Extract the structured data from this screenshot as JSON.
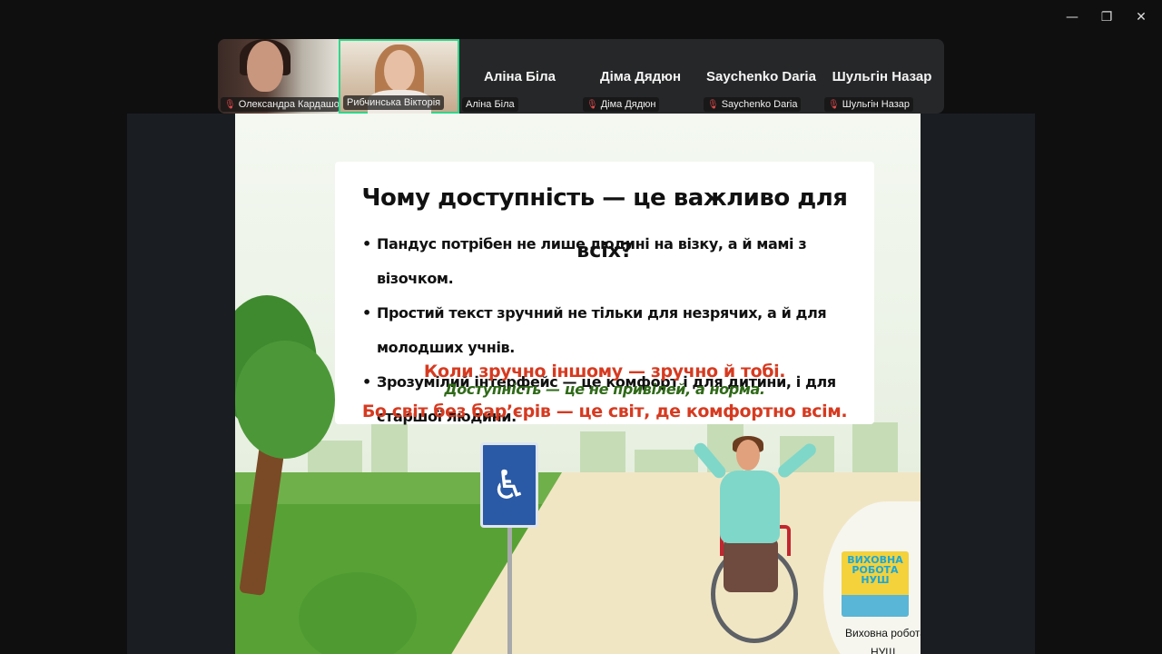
{
  "window": {
    "controls": {
      "minimize": "—",
      "restore": "❐",
      "close": "✕"
    }
  },
  "participants": [
    {
      "name": "Олександра Кардашо...",
      "has_video": true,
      "muted": true
    },
    {
      "name": "Рибчинська Вікторія",
      "has_video": true,
      "muted": false,
      "active_speaker": true
    },
    {
      "name": "Аліна Біла",
      "display_name": "Аліна Біла",
      "has_video": false,
      "muted": false
    },
    {
      "name": "Діма Дядюн",
      "display_name": "Діма Дядюн",
      "has_video": false,
      "muted": true
    },
    {
      "name": "Saychenko Daria",
      "display_name": "Saychenko Daria",
      "has_video": false,
      "muted": true
    },
    {
      "name": "Шульгін Назар",
      "display_name": "Шульгін Назар",
      "has_video": false,
      "muted": true
    }
  ],
  "slide": {
    "title_line1": "Чому доступність — це важливо для",
    "title_line2": "всіх?",
    "bullets": [
      "Пандус потрібен не лише людині на візку, а й мамі з візочком.",
      "Простий текст зручний не тільки для незрячих, а й для молодших учнів.",
      "Зрозумілий інтерфейс — це комфорт і для дитини, і для старшої людини."
    ],
    "red_line1": "Коли зручно іншому — зручно й тобі.",
    "green_line": "Доступність — це не привілей, а норма.",
    "red_line2": "Бо світ без бар’єрів — це світ, де комфортно всім.",
    "badge_title": "ВИХОВНА РОБОТА НУШ",
    "badge_caption_1": "Виховна робота",
    "badge_caption_2": "НУШ"
  },
  "icons": {
    "mic_muted": "muted-mic-icon",
    "wheelchair_sign": "wheelchair-sign-icon"
  },
  "colors": {
    "active_speaker_border": "#2fd68a",
    "slide_red": "#d63a20",
    "slide_green": "#2f6a18"
  }
}
